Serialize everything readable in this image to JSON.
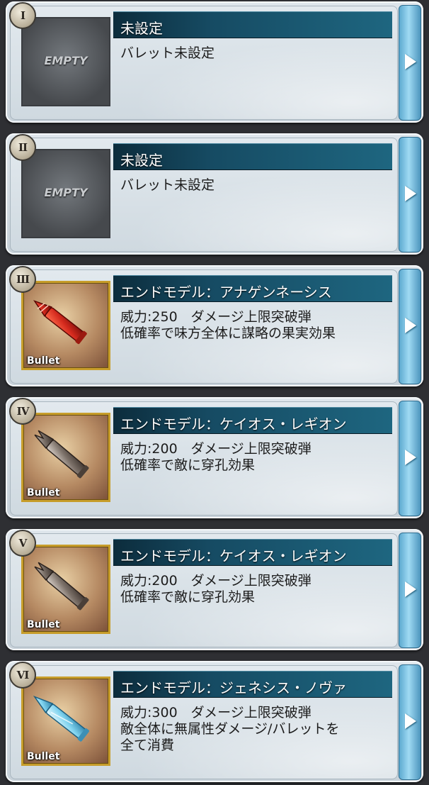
{
  "slots": [
    {
      "roman": "I",
      "state": "empty",
      "thumb_label": "EMPTY",
      "title": "未設定",
      "desc": [
        "バレット未設定"
      ]
    },
    {
      "roman": "II",
      "state": "empty",
      "thumb_label": "EMPTY",
      "title": "未設定",
      "desc": [
        "バレット未設定"
      ]
    },
    {
      "roman": "III",
      "state": "bullet",
      "thumb_label": "Bullet",
      "bullet_color": "red",
      "title": "エンドモデル：アナゲンネーシス",
      "desc": [
        "威力:250　ダメージ上限突破弾",
        "低確率で味方全体に謀略の果実効果"
      ]
    },
    {
      "roman": "IV",
      "state": "bullet",
      "thumb_label": "Bullet",
      "bullet_color": "steel",
      "title": "エンドモデル：ケイオス・レギオン",
      "desc": [
        "威力:200　ダメージ上限突破弾",
        "低確率で敵に穿孔効果"
      ]
    },
    {
      "roman": "V",
      "state": "bullet",
      "thumb_label": "Bullet",
      "bullet_color": "steel",
      "title": "エンドモデル：ケイオス・レギオン",
      "desc": [
        "威力:200　ダメージ上限突破弾",
        "低確率で敵に穿孔効果"
      ]
    },
    {
      "roman": "VI",
      "state": "bullet",
      "thumb_label": "Bullet",
      "bullet_color": "ice",
      "title": "エンドモデル：ジェネシス・ノヴァ",
      "desc": [
        "威力:300　ダメージ上限突破弾",
        "敵全体に無属性ダメージ/バレットを",
        "全て消費"
      ]
    }
  ],
  "colors": {
    "title_bar": "#164b63",
    "arrow_tab": "#7cc4e6",
    "bullet_frame": "#c79d2b",
    "bullet_red": "#d42a1e",
    "bullet_steel": "#7d726a",
    "bullet_ice": "#7fd3ef"
  },
  "icons": {
    "next": "arrow-right-icon"
  }
}
